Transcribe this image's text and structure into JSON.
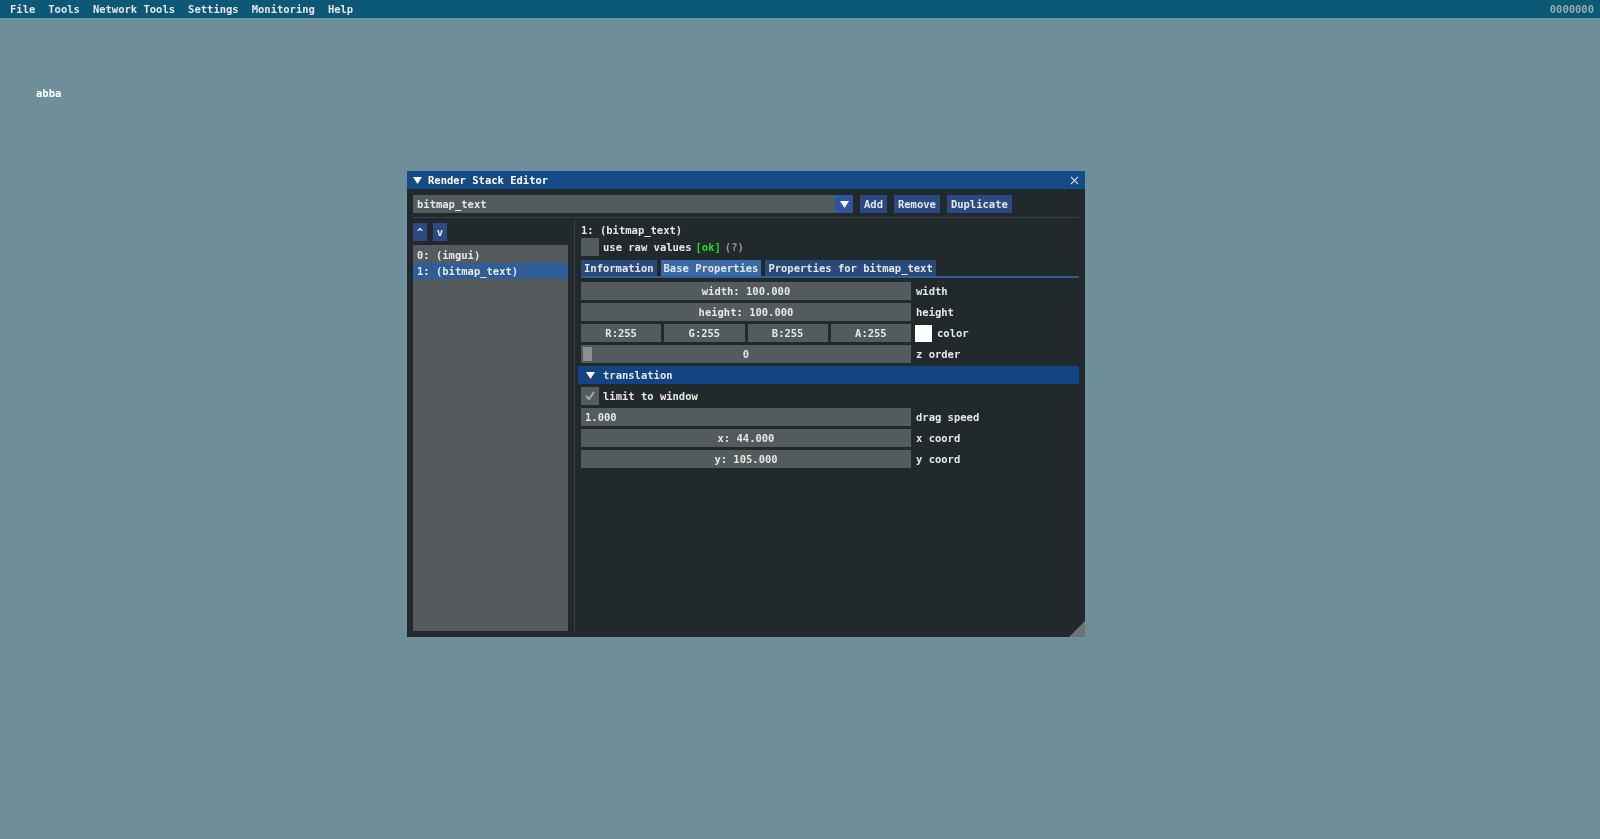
{
  "menu_bar": {
    "items": [
      "File",
      "Tools",
      "Network Tools",
      "Settings",
      "Monitoring",
      "Help"
    ],
    "status": "0000000"
  },
  "canvas_text": "abba",
  "window": {
    "title": "Render Stack Editor",
    "expanded": true,
    "combo": {
      "value": "bitmap_text"
    },
    "buttons": [
      "Add",
      "Remove",
      "Duplicate"
    ],
    "stack": {
      "move_buttons": [
        "^",
        "v"
      ],
      "items": [
        {
          "label": "0: (imgui)",
          "selected": false
        },
        {
          "label": "1: (bitmap_text)",
          "selected": true
        }
      ]
    },
    "inspector": {
      "heading": "1: (bitmap_text)",
      "raw_values": {
        "label": "use raw values",
        "checked": false,
        "status": "[ok]",
        "help": "(?)"
      },
      "tabs": [
        {
          "label": "Information",
          "selected": false
        },
        {
          "label": "Base Properties",
          "selected": true
        },
        {
          "label": "Properties for bitmap_text",
          "selected": false
        }
      ],
      "properties": [
        {
          "kind": "drag",
          "value": "width: 100.000",
          "label": "width"
        },
        {
          "kind": "drag",
          "value": "height: 100.000",
          "label": "height"
        },
        {
          "kind": "color",
          "channels": [
            "R:255",
            "G:255",
            "B:255",
            "A:255"
          ],
          "color": "#ffffff",
          "label": "color"
        },
        {
          "kind": "slider",
          "value": "0",
          "level": 0,
          "label": "z order"
        },
        {
          "kind": "header",
          "label": "translation",
          "expanded": true
        },
        {
          "kind": "checkbox",
          "text": "limit to window",
          "checked": true
        },
        {
          "kind": "input",
          "value": "1.000",
          "label": "drag speed"
        },
        {
          "kind": "drag",
          "value": "x: 44.000",
          "label": "x coord"
        },
        {
          "kind": "drag",
          "value": "y: 105.000",
          "label": "y coord"
        }
      ]
    }
  }
}
